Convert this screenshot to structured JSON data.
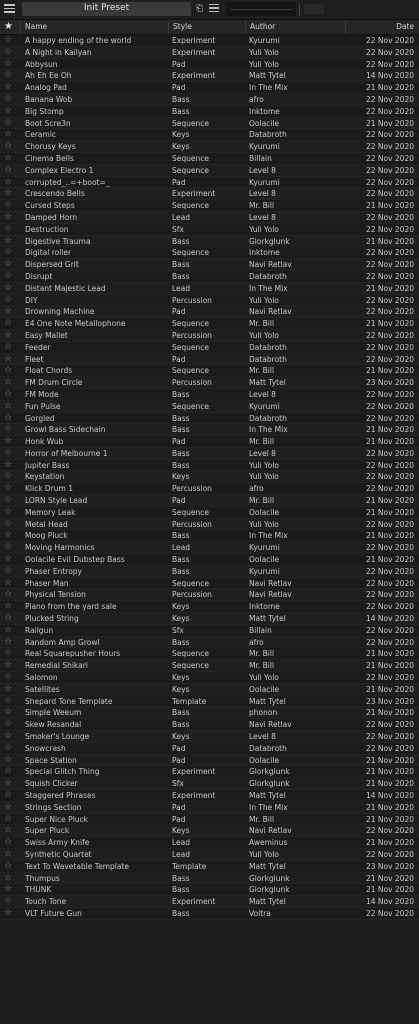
{
  "top": {
    "preset_name": "Init Preset"
  },
  "columns": {
    "name": "Name",
    "style": "Style",
    "author": "Author",
    "date": "Date"
  },
  "presets": [
    {
      "name": "A happy ending of the world",
      "style": "Experiment",
      "author": "Kyurumi",
      "date": "22 Nov 2020"
    },
    {
      "name": "A Night in Kailyan",
      "style": "Experiment",
      "author": "Yuli Yolo",
      "date": "22 Nov 2020"
    },
    {
      "name": "Abbysun",
      "style": "Pad",
      "author": "Yuli Yolo",
      "date": "22 Nov 2020"
    },
    {
      "name": "Ah Eh Ee Oh",
      "style": "Experiment",
      "author": "Matt Tytel",
      "date": "14 Nov 2020"
    },
    {
      "name": "Analog Pad",
      "style": "Pad",
      "author": "In The Mix",
      "date": "21 Nov 2020"
    },
    {
      "name": "Banana Wob",
      "style": "Bass",
      "author": "afro",
      "date": "22 Nov 2020"
    },
    {
      "name": "Big Stomp",
      "style": "Bass",
      "author": "Inktome",
      "date": "22 Nov 2020"
    },
    {
      "name": "Boot Scre3n",
      "style": "Sequence",
      "author": "Oolacile",
      "date": "21 Nov 2020"
    },
    {
      "name": "Ceramic",
      "style": "Keys",
      "author": "Databroth",
      "date": "22 Nov 2020"
    },
    {
      "name": "Chorusy Keys",
      "style": "Keys",
      "author": "Kyurumi",
      "date": "22 Nov 2020"
    },
    {
      "name": "Cinema Bells",
      "style": "Sequence",
      "author": "Billain",
      "date": "22 Nov 2020"
    },
    {
      "name": "Complex Electro 1",
      "style": "Sequence",
      "author": "Level 8",
      "date": "22 Nov 2020"
    },
    {
      "name": "corrupted_..=+boot=_",
      "style": "Pad",
      "author": "Kyurumi",
      "date": "22 Nov 2020"
    },
    {
      "name": "Crescendo Bells",
      "style": "Experiment",
      "author": "Level 8",
      "date": "22 Nov 2020"
    },
    {
      "name": "Cursed Steps",
      "style": "Sequence",
      "author": "Mr. Bill",
      "date": "21 Nov 2020"
    },
    {
      "name": "Damped Horn",
      "style": "Lead",
      "author": "Level 8",
      "date": "22 Nov 2020"
    },
    {
      "name": "Destruction",
      "style": "Sfx",
      "author": "Yuli Yolo",
      "date": "22 Nov 2020"
    },
    {
      "name": "Digestive Trauma",
      "style": "Bass",
      "author": "Glorkglunk",
      "date": "21 Nov 2020"
    },
    {
      "name": "Digital roller",
      "style": "Sequence",
      "author": "Inktome",
      "date": "22 Nov 2020"
    },
    {
      "name": "Dispersed Grit",
      "style": "Bass",
      "author": "Navi Retlav",
      "date": "22 Nov 2020"
    },
    {
      "name": "Disrupt",
      "style": "Bass",
      "author": "Databroth",
      "date": "22 Nov 2020"
    },
    {
      "name": "Distant Majestic Lead",
      "style": "Lead",
      "author": "In The Mix",
      "date": "21 Nov 2020"
    },
    {
      "name": "DIY",
      "style": "Percussion",
      "author": "Yuli Yolo",
      "date": "22 Nov 2020"
    },
    {
      "name": "Drowning Machine",
      "style": "Pad",
      "author": "Navi Retlav",
      "date": "22 Nov 2020"
    },
    {
      "name": "E4 One Note Metallophone",
      "style": "Sequence",
      "author": "Mr. Bill",
      "date": "21 Nov 2020"
    },
    {
      "name": "Easy Mallet",
      "style": "Percussion",
      "author": "Yuli Yolo",
      "date": "22 Nov 2020"
    },
    {
      "name": "Feeder",
      "style": "Sequence",
      "author": "Databroth",
      "date": "22 Nov 2020"
    },
    {
      "name": "Fleet",
      "style": "Pad",
      "author": "Databroth",
      "date": "22 Nov 2020"
    },
    {
      "name": "Float Chords",
      "style": "Sequence",
      "author": "Mr. Bill",
      "date": "21 Nov 2020"
    },
    {
      "name": "FM Drum Circle",
      "style": "Percussion",
      "author": "Matt Tytel",
      "date": "23 Nov 2020"
    },
    {
      "name": "FM Mode",
      "style": "Bass",
      "author": "Level 8",
      "date": "22 Nov 2020"
    },
    {
      "name": "Fun Pulse",
      "style": "Sequence",
      "author": "Kyurumi",
      "date": "22 Nov 2020"
    },
    {
      "name": "Gorgled",
      "style": "Bass",
      "author": "Databroth",
      "date": "22 Nov 2020"
    },
    {
      "name": "Growl Bass Sidechain",
      "style": "Bass",
      "author": "In The Mix",
      "date": "21 Nov 2020"
    },
    {
      "name": "Honk Wub",
      "style": "Pad",
      "author": "Mr. Bill",
      "date": "21 Nov 2020"
    },
    {
      "name": "Horror of Melbourne 1",
      "style": "Bass",
      "author": "Level 8",
      "date": "22 Nov 2020"
    },
    {
      "name": "Jupiter Bass",
      "style": "Bass",
      "author": "Yuli Yolo",
      "date": "22 Nov 2020"
    },
    {
      "name": "Keystation",
      "style": "Keys",
      "author": "Yuli Yolo",
      "date": "22 Nov 2020"
    },
    {
      "name": "Klick Drum 1",
      "style": "Percussion",
      "author": "afro",
      "date": "22 Nov 2020"
    },
    {
      "name": "LORN Style Lead",
      "style": "Pad",
      "author": "Mr. Bill",
      "date": "21 Nov 2020"
    },
    {
      "name": "Memory Leak",
      "style": "Sequence",
      "author": "Oolacile",
      "date": "21 Nov 2020"
    },
    {
      "name": "Metal Head",
      "style": "Percussion",
      "author": "Yuli Yolo",
      "date": "22 Nov 2020"
    },
    {
      "name": "Moog Pluck",
      "style": "Bass",
      "author": "In The Mix",
      "date": "21 Nov 2020"
    },
    {
      "name": "Moving Harmonics",
      "style": "Lead",
      "author": "Kyurumi",
      "date": "22 Nov 2020"
    },
    {
      "name": "Oolacile Evil Dubstep Bass",
      "style": "Bass",
      "author": "Oolacile",
      "date": "21 Nov 2020"
    },
    {
      "name": "Phaser Entropy",
      "style": "Bass",
      "author": "Kyurumi",
      "date": "22 Nov 2020"
    },
    {
      "name": "Phaser Man",
      "style": "Sequence",
      "author": "Navi Retlav",
      "date": "22 Nov 2020"
    },
    {
      "name": "Physical Tension",
      "style": "Percussion",
      "author": "Navi Retlav",
      "date": "22 Nov 2020"
    },
    {
      "name": "Piano from the yard sale",
      "style": "Keys",
      "author": "Inktome",
      "date": "22 Nov 2020"
    },
    {
      "name": "Plucked String",
      "style": "Keys",
      "author": "Matt Tytel",
      "date": "14 Nov 2020"
    },
    {
      "name": "Railgun",
      "style": "Sfx",
      "author": "Billain",
      "date": "22 Nov 2020"
    },
    {
      "name": "Random Amp Growl",
      "style": "Bass",
      "author": "afro",
      "date": "22 Nov 2020"
    },
    {
      "name": "Real Squarepusher Hours",
      "style": "Sequence",
      "author": "Mr. Bill",
      "date": "21 Nov 2020"
    },
    {
      "name": "Remedial Shikari",
      "style": "Sequence",
      "author": "Mr. Bill",
      "date": "21 Nov 2020"
    },
    {
      "name": "Salomon",
      "style": "Keys",
      "author": "Yuli Yolo",
      "date": "22 Nov 2020"
    },
    {
      "name": "Satellites",
      "style": "Keys",
      "author": "Oolacile",
      "date": "21 Nov 2020"
    },
    {
      "name": "Shepard Tone Template",
      "style": "Template",
      "author": "Matt Tytel",
      "date": "23 Nov 2020"
    },
    {
      "name": "Simple Weeum",
      "style": "Bass",
      "author": "phonon",
      "date": "21 Nov 2020"
    },
    {
      "name": "Skew Resandal",
      "style": "Bass",
      "author": "Navi Retlav",
      "date": "22 Nov 2020"
    },
    {
      "name": "Smoker's Lounge",
      "style": "Keys",
      "author": "Level 8",
      "date": "22 Nov 2020"
    },
    {
      "name": "Snowcrash",
      "style": "Pad",
      "author": "Databroth",
      "date": "22 Nov 2020"
    },
    {
      "name": "Space Station",
      "style": "Pad",
      "author": "Oolacile",
      "date": "21 Nov 2020"
    },
    {
      "name": "Special Glitch Thing",
      "style": "Experiment",
      "author": "Glorkglunk",
      "date": "21 Nov 2020"
    },
    {
      "name": "Squish Clicker",
      "style": "Sfx",
      "author": "Glorkglunk",
      "date": "21 Nov 2020"
    },
    {
      "name": "Staggered Phrases",
      "style": "Experiment",
      "author": "Matt Tytel",
      "date": "14 Nov 2020"
    },
    {
      "name": "Strings Section",
      "style": "Pad",
      "author": "In The Mix",
      "date": "21 Nov 2020"
    },
    {
      "name": "Super Nice Pluck",
      "style": "Pad",
      "author": "Mr. Bill",
      "date": "21 Nov 2020"
    },
    {
      "name": "Super Pluck",
      "style": "Keys",
      "author": "Navi Retlav",
      "date": "22 Nov 2020"
    },
    {
      "name": "Swiss Army Knife",
      "style": "Lead",
      "author": "Aweminus",
      "date": "21 Nov 2020"
    },
    {
      "name": "Synthetic Quartet",
      "style": "Lead",
      "author": "Yuli Yolo",
      "date": "22 Nov 2020"
    },
    {
      "name": "Text To Wavetable Template",
      "style": "Template",
      "author": "Matt Tytel",
      "date": "23 Nov 2020"
    },
    {
      "name": "Thumpus",
      "style": "Bass",
      "author": "Glorkglunk",
      "date": "21 Nov 2020"
    },
    {
      "name": "THUNK",
      "style": "Bass",
      "author": "Glorkglunk",
      "date": "21 Nov 2020"
    },
    {
      "name": "Touch Tone",
      "style": "Experiment",
      "author": "Matt Tytel",
      "date": "14 Nov 2020"
    },
    {
      "name": "VLT Future Gun",
      "style": "Bass",
      "author": "Voltra",
      "date": "22 Nov 2020"
    }
  ]
}
